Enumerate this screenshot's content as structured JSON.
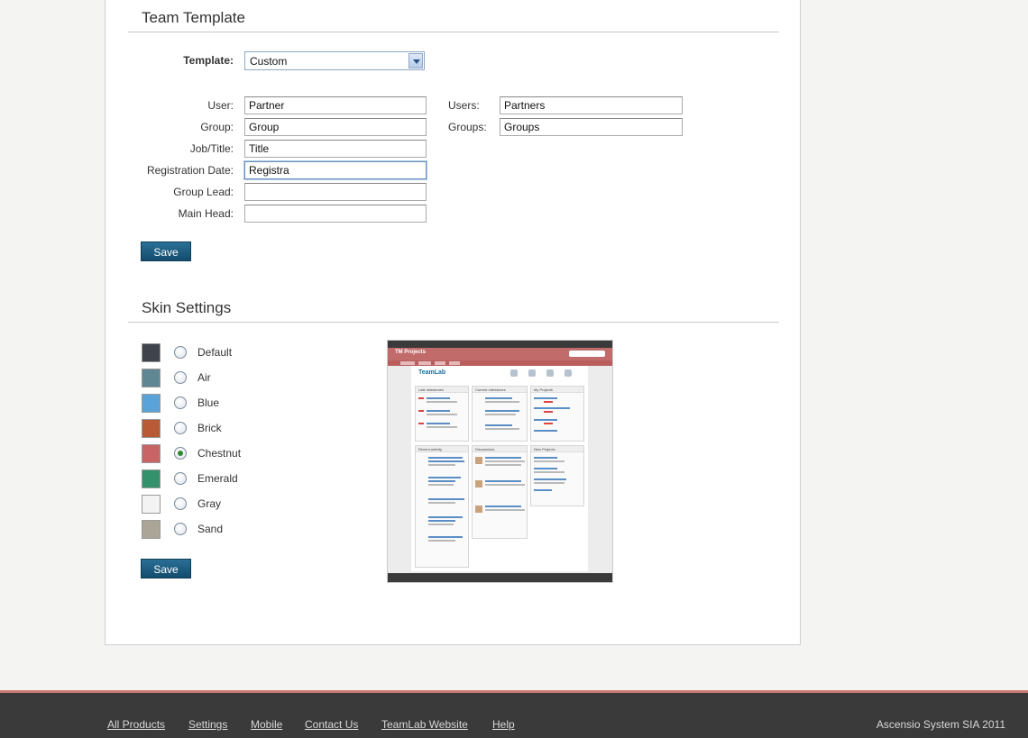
{
  "team_template": {
    "title": "Team Template",
    "template_label": "Template:",
    "template_value": "Custom",
    "fields": [
      {
        "label": "User:",
        "value": "Partner"
      },
      {
        "label": "Group:",
        "value": "Group"
      },
      {
        "label": "Job/Title:",
        "value": "Title"
      },
      {
        "label": "Registration Date:",
        "value": "Registra"
      },
      {
        "label": "Group Lead:",
        "value": ""
      },
      {
        "label": "Main Head:",
        "value": ""
      }
    ],
    "plural_fields": [
      {
        "label": "Users:",
        "value": "Partners"
      },
      {
        "label": "Groups:",
        "value": "Groups"
      }
    ],
    "save_label": "Save"
  },
  "skin_settings": {
    "title": "Skin Settings",
    "selected": "Chestnut",
    "skins": [
      {
        "name": "Default",
        "color": "#3f434b"
      },
      {
        "name": "Air",
        "color": "#5f8693"
      },
      {
        "name": "Blue",
        "color": "#5aa3d8"
      },
      {
        "name": "Brick",
        "color": "#b85a36"
      },
      {
        "name": "Chestnut",
        "color": "#c96464"
      },
      {
        "name": "Emerald",
        "color": "#33926b"
      },
      {
        "name": "Gray",
        "color": "#f3f3f3"
      },
      {
        "name": "Sand",
        "color": "#aba597"
      }
    ],
    "save_label": "Save",
    "preview": {
      "header_title": "TM Projects",
      "logo_text": "TeamLab",
      "columns": [
        "Late milestones",
        "Current milestones",
        "My Projects",
        "Recent activity",
        "Discussions",
        "New Projects"
      ]
    }
  },
  "footer": {
    "links": [
      "All Products",
      "Settings",
      "Mobile",
      "Contact Us",
      "TeamLab Website",
      "Help"
    ],
    "copyright": "Ascensio System SIA 2011"
  }
}
